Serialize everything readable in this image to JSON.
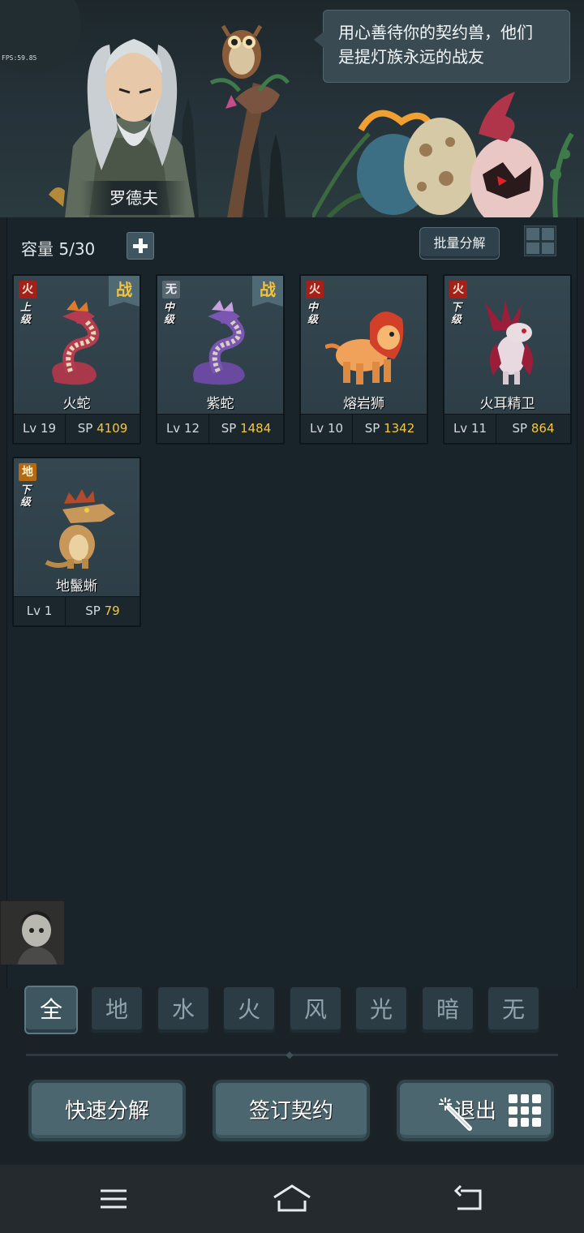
{
  "scene": {
    "fps": "FPS:59.85",
    "dialogue": [
      "用心善待你的契约兽，他们",
      "是提灯族永远的战友"
    ],
    "npc_name": "罗德夫"
  },
  "toolbar": {
    "capacity_label": "容量",
    "capacity_value": "5/30",
    "batch_decompose": "批量分解"
  },
  "monsters": [
    {
      "element": "火",
      "element_color": "#a3201b",
      "grade": [
        "上",
        "级"
      ],
      "battle": "战",
      "name": "火蛇",
      "lv_label": "Lv",
      "lv": "19",
      "sp_label": "SP",
      "sp": "4109"
    },
    {
      "element": "无",
      "element_color": "#59676e",
      "grade": [
        "中",
        "级"
      ],
      "battle": "战",
      "name": "紫蛇",
      "lv_label": "Lv",
      "lv": "12",
      "sp_label": "SP",
      "sp": "1484"
    },
    {
      "element": "火",
      "element_color": "#a3201b",
      "grade": [
        "中",
        "级"
      ],
      "battle": "",
      "name": "熔岩狮",
      "lv_label": "Lv",
      "lv": "10",
      "sp_label": "SP",
      "sp": "1342"
    },
    {
      "element": "火",
      "element_color": "#a3201b",
      "grade": [
        "下",
        "级"
      ],
      "battle": "",
      "name": "火耳精卫",
      "lv_label": "Lv",
      "lv": "11",
      "sp_label": "SP",
      "sp": "864"
    },
    {
      "element": "地",
      "element_color": "#b36a13",
      "grade": [
        "下",
        "级"
      ],
      "battle": "",
      "name": "地鬣蜥",
      "lv_label": "Lv",
      "lv": "1",
      "sp_label": "SP",
      "sp": "79"
    }
  ],
  "filters": [
    "全",
    "地",
    "水",
    "火",
    "风",
    "光",
    "暗",
    "无"
  ],
  "active_filter": "全",
  "actions": {
    "quick_decompose": "快速分解",
    "sign_contract": "签订契约",
    "exit": "退出"
  },
  "icons": {
    "plus": "plus-icon",
    "view_toggle": "grid-view-icon",
    "wand": "magic-wand-icon",
    "apps": "app-grid-icon",
    "nav_menu": "menu-icon",
    "nav_home": "home-icon",
    "nav_back": "back-icon"
  },
  "colors": {
    "accent_gold": "#f4c83c",
    "fire": "#a3201b",
    "earth": "#b36a13",
    "none": "#59676e"
  }
}
